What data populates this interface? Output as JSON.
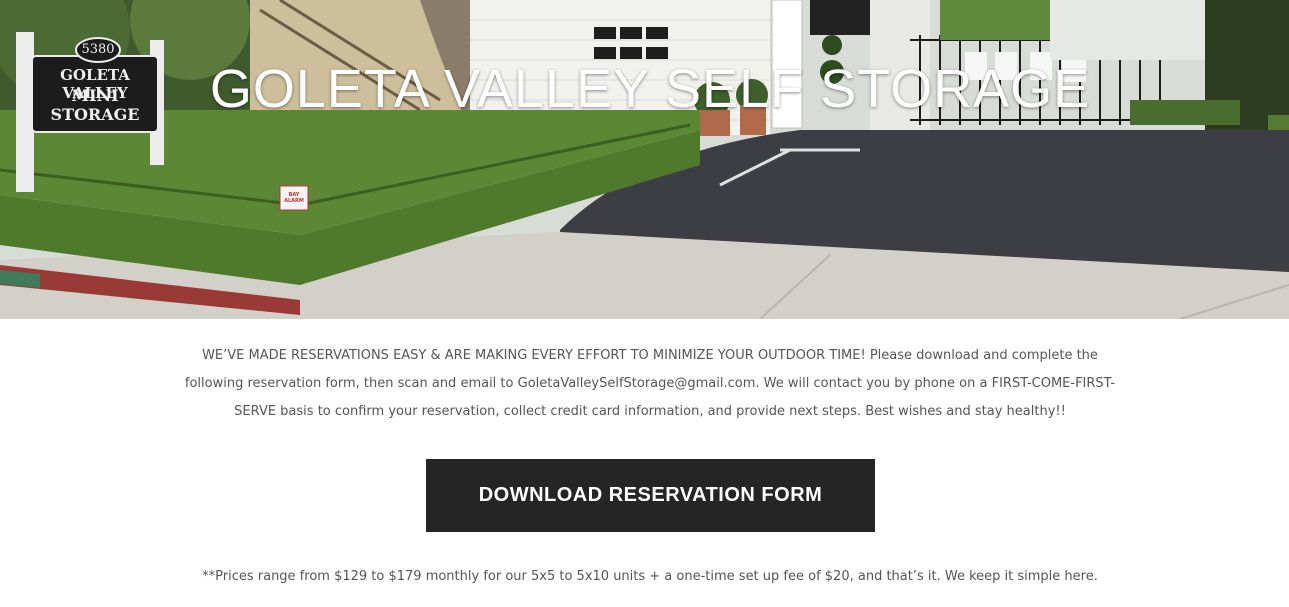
{
  "hero": {
    "title": "GOLETA VALLEY SELF STORAGE",
    "sign": {
      "number": "5380",
      "line1": "GOLETA VALLEY",
      "line2": "MINI",
      "line3": "STORAGE"
    },
    "alarm_sign": "BAY ALARM"
  },
  "intro": {
    "text_before_email": "WE’VE MADE RESERVATIONS EASY & ARE MAKING EVERY EFFORT TO MINIMIZE YOUR OUTDOOR TIME!  Please download and complete the following reservation form, then scan and email to ",
    "email": "GoletaValleySelfStorage@gmail.com",
    "text_after_email": ". We will contact you by phone on a FIRST-COME-FIRST-SERVE basis to confirm your reservation, collect credit card information, and provide next steps. Best wishes and stay healthy!!"
  },
  "download_button": {
    "label": "DOWNLOAD RESERVATION FORM"
  },
  "prices_note": "**Prices range from $129 to $179 monthly for our 5x5 to 5x10 units + a one-time set up fee of $20, and that’s it. We keep it simple here.",
  "colors": {
    "button_bg": "#252525",
    "body_text": "#555555",
    "hero_text": "#ffffff"
  }
}
